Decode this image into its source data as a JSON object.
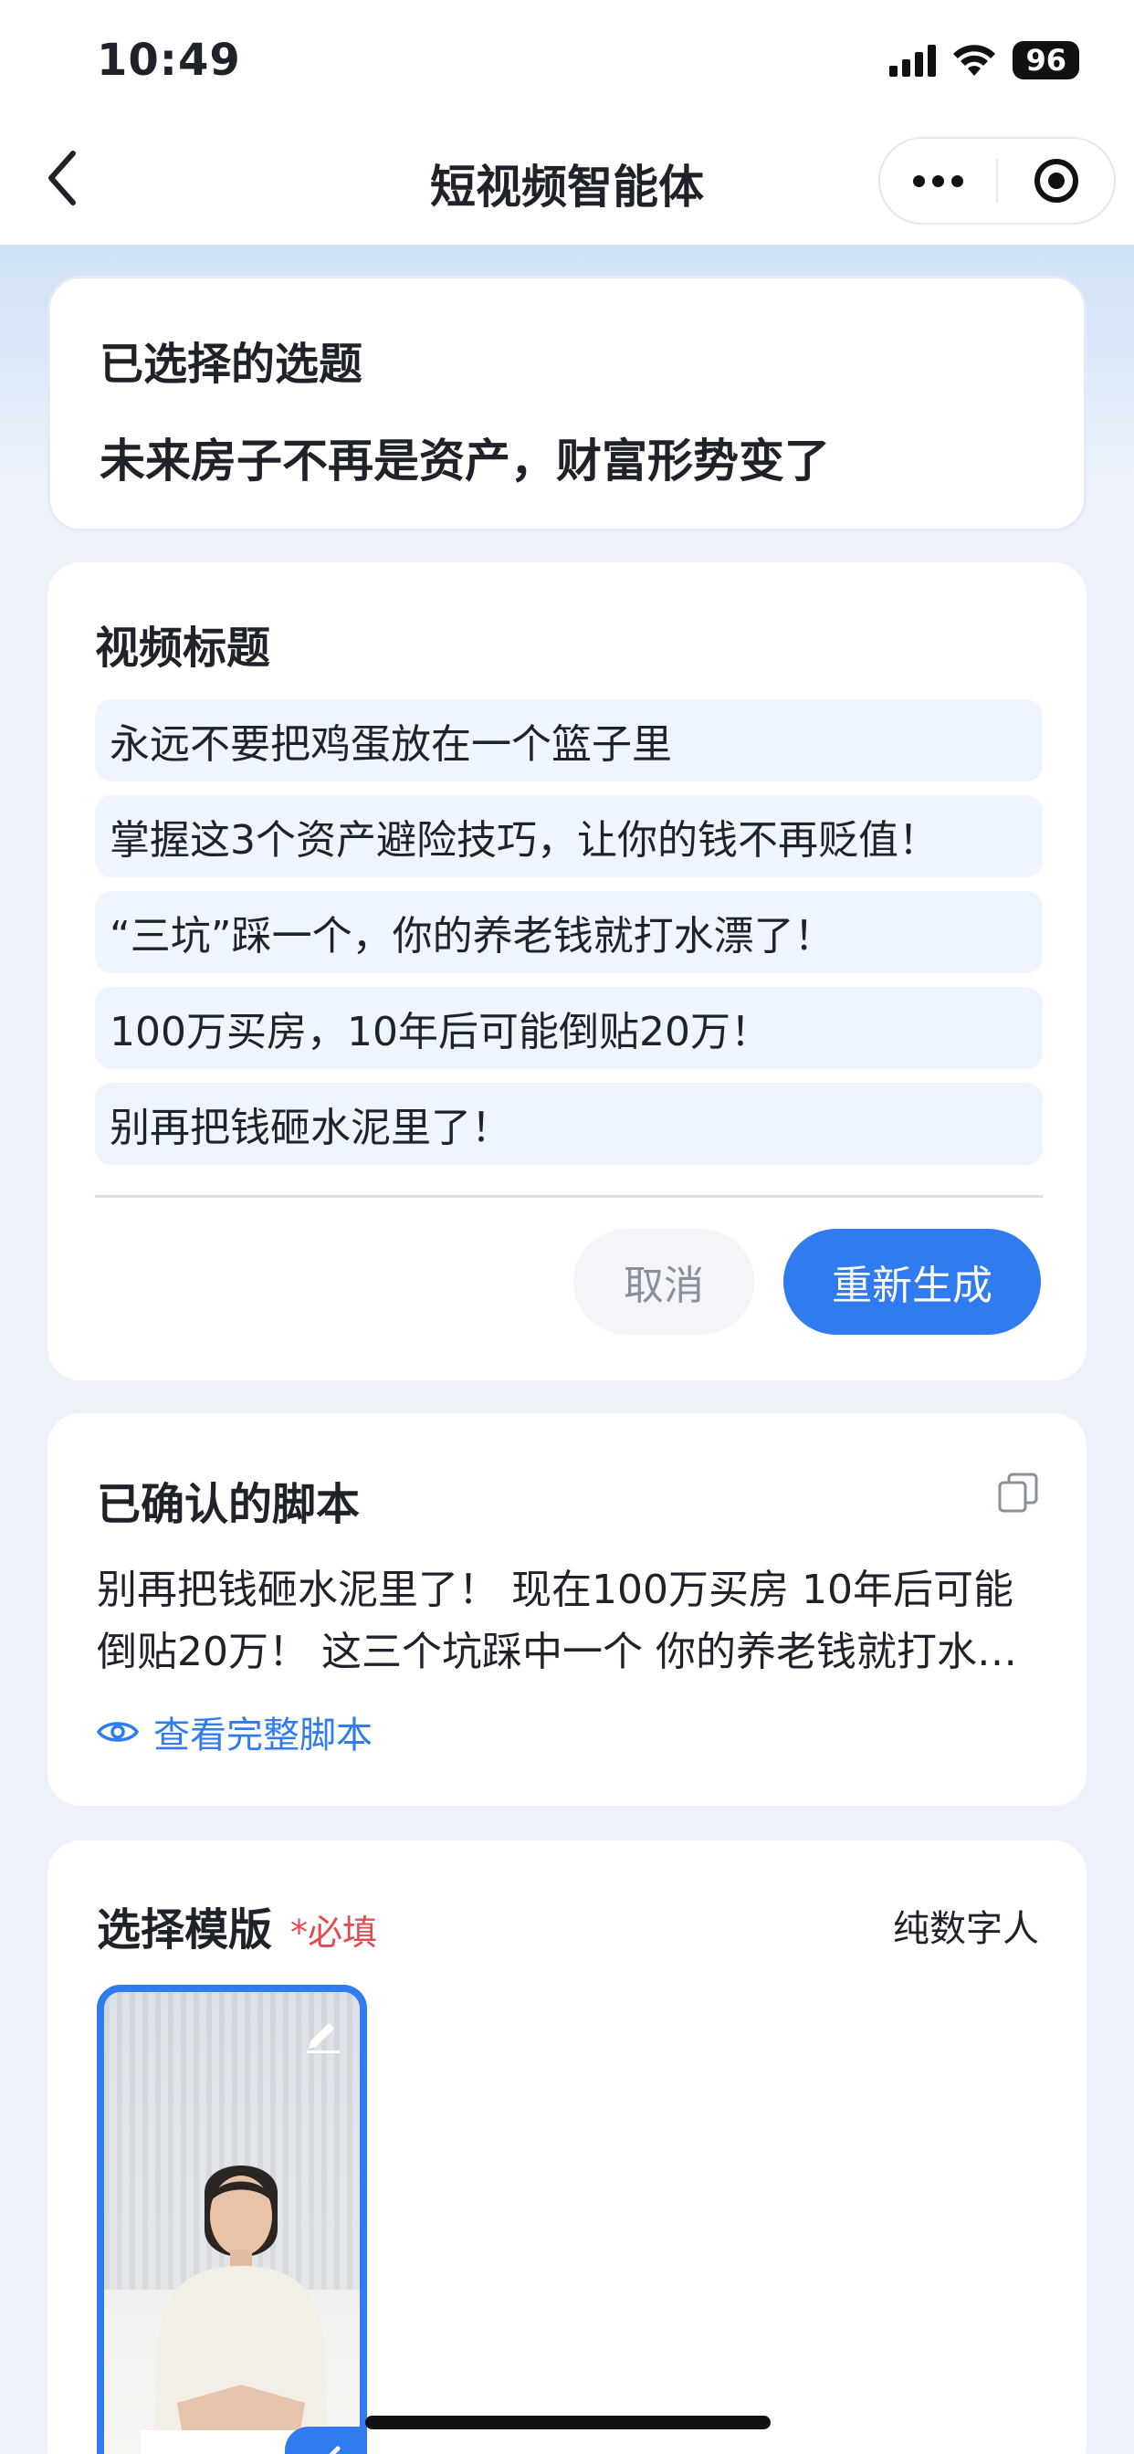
{
  "status_bar": {
    "time": "10:49",
    "battery": "96"
  },
  "nav": {
    "title": "短视频智能体"
  },
  "selected_topic": {
    "label": "已选择的选题",
    "value": "未来房子不再是资产，财富形势变了"
  },
  "video_titles": {
    "heading": "视频标题",
    "items": [
      "永远不要把鸡蛋放在一个篮子里",
      "掌握这3个资产避险技巧，让你的钱不再贬值！",
      "“三坑”踩一个，你的养老钱就打水漂了！",
      "100万买房，10年后可能倒贴20万！",
      "别再把钱砸水泥里了！"
    ],
    "cancel_label": "取消",
    "regenerate_label": "重新生成"
  },
  "script": {
    "heading": "已确认的脚本",
    "text": "别再把钱砸水泥里了！  现在100万买房 10年后可能倒贴20万！  这三个坑踩中一个 你的养老钱就打水漂了！",
    "view_full_label": "查看完整脚本"
  },
  "template": {
    "heading": "选择模版",
    "required_label": "*必填",
    "type_label": "纯数字人"
  },
  "colors": {
    "accent": "#2f7bef",
    "required": "#e5484d",
    "title_item_bg": "#eef5ff"
  }
}
